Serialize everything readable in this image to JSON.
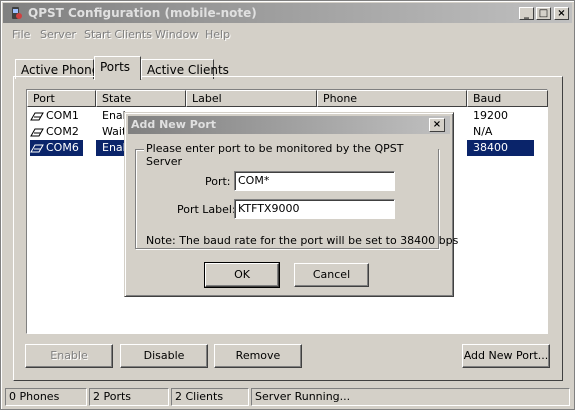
{
  "window": {
    "title": "QPST Configuration (mobile-note)",
    "controls": {
      "minimize": "_",
      "maximize": "□",
      "close": "×"
    }
  },
  "menu": [
    {
      "label": "File"
    },
    {
      "label": "Server"
    },
    {
      "label": "Start Clients"
    },
    {
      "label": "Window"
    },
    {
      "label": "Help"
    }
  ],
  "tabs": [
    {
      "label": "Active Phones",
      "active": false
    },
    {
      "label": "Ports",
      "active": true
    },
    {
      "label": "Active Clients",
      "active": false
    }
  ],
  "ports_table": {
    "columns": [
      "Port",
      "State",
      "Label",
      "Phone",
      "Baud"
    ],
    "rows": [
      {
        "port": "COM1",
        "state": "Enab",
        "label": "",
        "phone": "",
        "baud": "19200",
        "selected": false
      },
      {
        "port": "COM2",
        "state": "Wait",
        "label": "",
        "phone": "",
        "baud": "N/A",
        "selected": false
      },
      {
        "port": "COM6",
        "state": "Enab",
        "label": "",
        "phone": "",
        "baud": "38400",
        "selected": true
      }
    ]
  },
  "buttons": {
    "enable": "Enable",
    "disable": "Disable",
    "remove": "Remove",
    "add_new_port": "Add New Port..."
  },
  "statusbar": {
    "phones": "0 Phones",
    "ports": "2 Ports",
    "clients": "2 Clients",
    "server": "Server Running..."
  },
  "dialog": {
    "title": "Add New Port",
    "close": "×",
    "group_label": "Please enter port to be monitored by the QPST Server",
    "port_label": "Port:",
    "port_value": "COM*",
    "port_label_label": "Port Label:",
    "port_label_value": "KTFTX9000",
    "note": "Note: The baud rate for the port will be set to 38400 bps",
    "ok": "OK",
    "cancel": "Cancel"
  },
  "colors": {
    "selection": "#0a246a",
    "titlebar_inactive": "#808080",
    "face": "#d4d0c8"
  }
}
